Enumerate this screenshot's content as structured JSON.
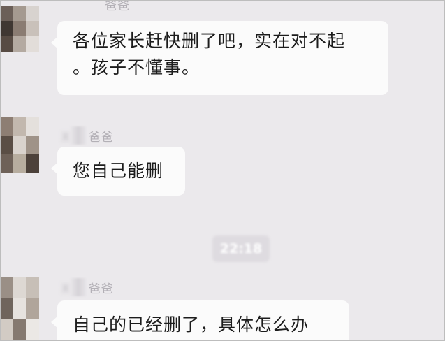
{
  "messages": [
    {
      "sender": "爸爸",
      "text_line1": "各位家长赶快删了吧，实在对不起",
      "text_line2": "。孩子不懂事。"
    },
    {
      "sender": "爸爸",
      "text": "您自己能删"
    },
    {
      "sender": "爸爸",
      "text": "自己的已经删了，具体怎么办"
    }
  ],
  "timestamp": "22:18",
  "colors": {
    "background": "#ebe9ec",
    "bubble": "#fbfbfb",
    "text": "#1c1c1c",
    "sender_name": "#b3b0b6"
  }
}
